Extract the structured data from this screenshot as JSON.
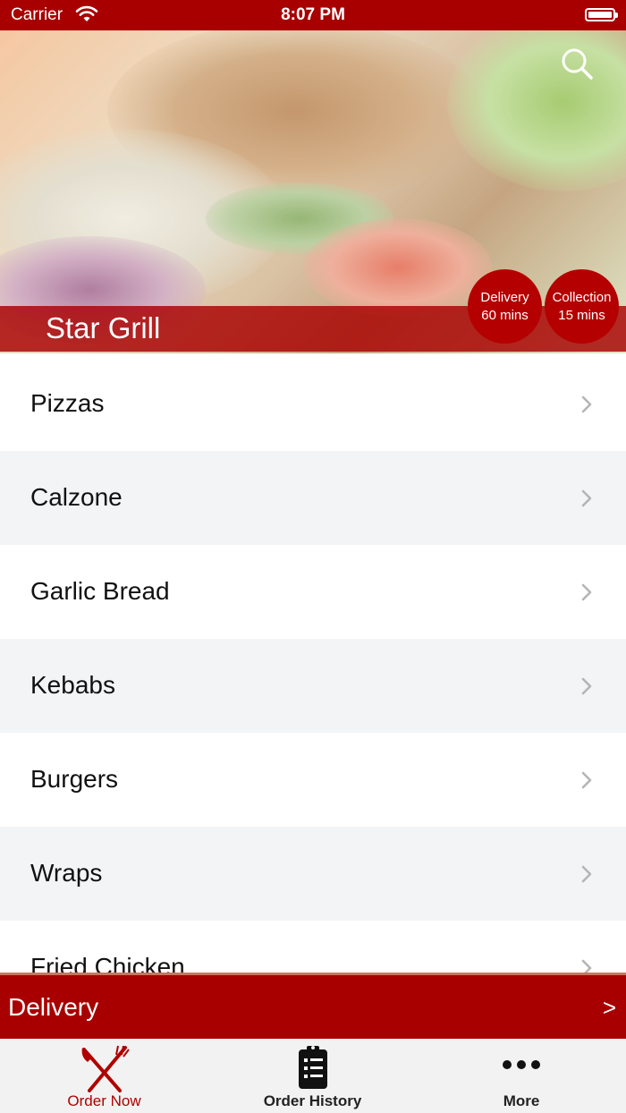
{
  "status_bar": {
    "carrier": "Carrier",
    "time": "8:07 PM"
  },
  "hero": {
    "restaurant_name": "Star Grill"
  },
  "badges": {
    "delivery": {
      "label": "Delivery",
      "time": "60 mins"
    },
    "collection": {
      "label": "Collection",
      "time": "15 mins"
    }
  },
  "menu": {
    "categories": [
      {
        "label": "Pizzas"
      },
      {
        "label": "Calzone"
      },
      {
        "label": "Garlic Bread"
      },
      {
        "label": "Kebabs"
      },
      {
        "label": "Burgers"
      },
      {
        "label": "Wraps"
      },
      {
        "label": "Fried Chicken"
      }
    ]
  },
  "order_mode": {
    "label": "Delivery",
    "arrow": ">"
  },
  "tab_bar": {
    "tabs": [
      {
        "label": "Order Now",
        "icon": "fork-knife-icon",
        "active": true
      },
      {
        "label": "Order History",
        "icon": "clipboard-list-icon",
        "active": false
      },
      {
        "label": "More",
        "icon": "more-dots-icon",
        "active": false
      }
    ]
  },
  "colors": {
    "brand_red": "#a80000",
    "active_tab": "#b00000",
    "alt_row": "#f3f4f6"
  }
}
